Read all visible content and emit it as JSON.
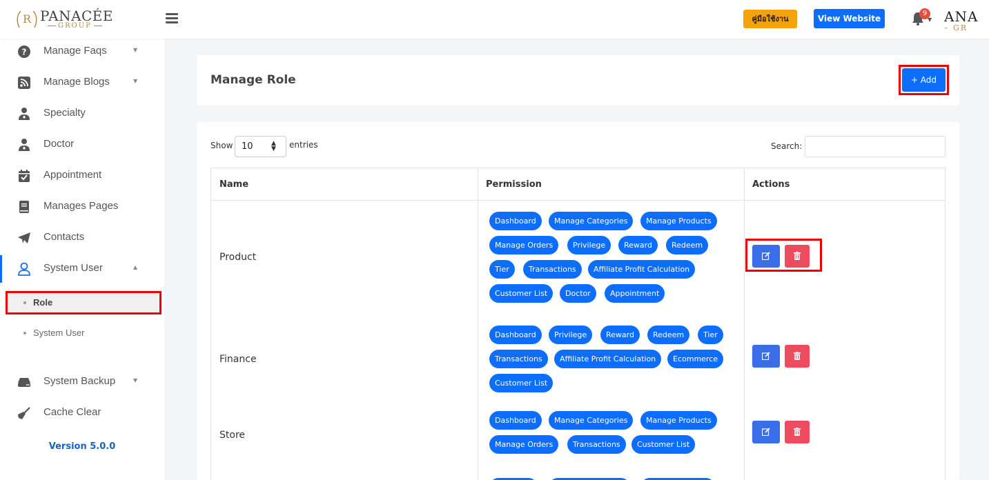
{
  "header": {
    "logo_brand": "PANACÉE",
    "logo_sub": "GROUP",
    "logo_mark": "R",
    "manual_button": "คู่มือใช้งาน",
    "view_website_button": "View Website",
    "notification_count": "9",
    "right_logo_top": "ANA",
    "right_logo_bottom": "– GR"
  },
  "sidebar": {
    "items": [
      {
        "label": "Manage Faqs",
        "icon": "question-circle-icon"
      },
      {
        "label": "Manage Blogs",
        "icon": "rss-icon"
      },
      {
        "label": "Specialty",
        "icon": "user-doctor-icon"
      },
      {
        "label": "Doctor",
        "icon": "user-doctor-icon"
      },
      {
        "label": "Appointment",
        "icon": "calendar-check-icon"
      },
      {
        "label": "Manages Pages",
        "icon": "book-icon"
      },
      {
        "label": "Contacts",
        "icon": "paper-plane-icon"
      },
      {
        "label": "System User",
        "icon": "user-icon"
      },
      {
        "label": "System Backup",
        "icon": "hdd-icon"
      },
      {
        "label": "Cache Clear",
        "icon": "broom-icon"
      }
    ],
    "sub_items": [
      {
        "label": "Role"
      },
      {
        "label": "System User"
      }
    ],
    "version": "Version 5.0.0"
  },
  "page": {
    "title": "Manage Role",
    "add_button": "+ Add",
    "show_label": "Show",
    "entries_value": "10",
    "entries_label": "entries",
    "search_label": "Search:",
    "search_value": ""
  },
  "table": {
    "columns": [
      "Name",
      "Permission",
      "Actions"
    ],
    "rows": [
      {
        "name": "Product",
        "permissions": [
          "Dashboard",
          "Manage Categories",
          "Manage Products",
          "Manage Orders",
          "Privilege",
          "Reward",
          "Redeem",
          "Tier",
          "Transactions",
          "Affiliate Profit Calculation",
          "Customer List",
          "Doctor",
          "Appointment"
        ]
      },
      {
        "name": "Finance",
        "permissions": [
          "Dashboard",
          "Privilege",
          "Reward",
          "Redeem",
          "Tier",
          "Transactions",
          "Affiliate Profit Calculation",
          "Ecommerce",
          "Customer List"
        ]
      },
      {
        "name": "Store",
        "permissions": [
          "Dashboard",
          "Manage Categories",
          "Manage Products",
          "Manage Orders",
          "Transactions",
          "Customer List"
        ]
      }
    ]
  },
  "colors": {
    "primary": "#0d6efd",
    "danger": "#ef4b5e",
    "warning": "#f5a30b",
    "highlight": "#ee0000",
    "version_text": "#1565c0"
  }
}
